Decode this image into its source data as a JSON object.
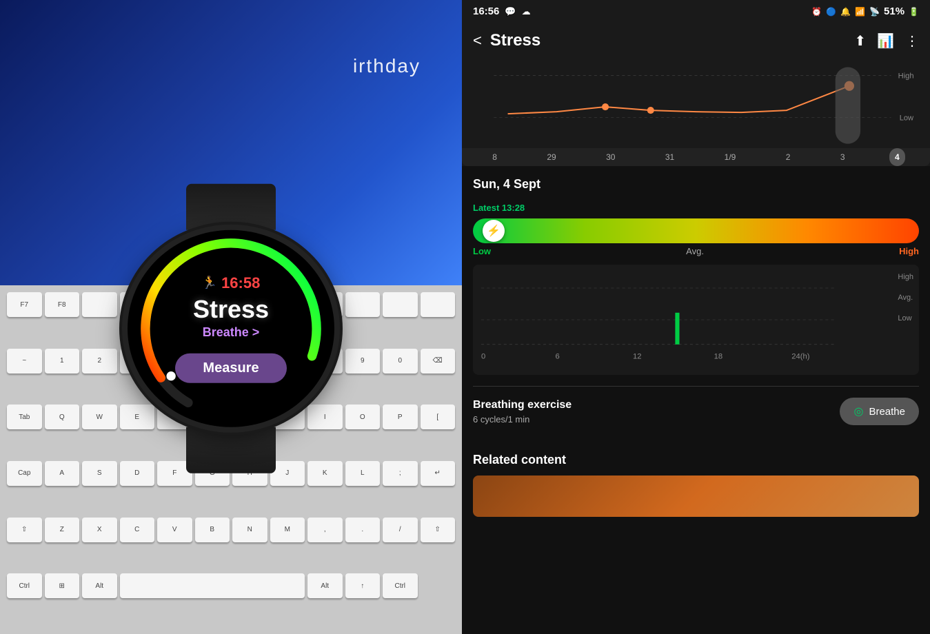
{
  "left_panel": {
    "birthday_text": "irthday",
    "watch": {
      "time": "16:58",
      "stress_label": "Stress",
      "breathe_label": "Breathe >",
      "measure_label": "Measure"
    }
  },
  "right_panel": {
    "status_bar": {
      "time": "16:56",
      "battery": "51%",
      "icons": "📱🔔📶"
    },
    "header": {
      "title": "Stress",
      "back_label": "<",
      "share_icon": "share",
      "chart_icon": "chart",
      "more_icon": "more"
    },
    "chart": {
      "y_labels": [
        "High",
        "Low"
      ],
      "x_labels": [
        "8",
        "29",
        "30",
        "31",
        "1/9",
        "2",
        "3",
        "4"
      ]
    },
    "date_heading": "Sun, 4 Sept",
    "latest_label": "Latest 13:28",
    "stress_bar": {
      "low_label": "Low",
      "avg_label": "Avg.",
      "high_label": "High"
    },
    "daily_chart": {
      "y_labels": [
        "High",
        "Avg.",
        "Low"
      ],
      "x_labels": [
        "0",
        "6",
        "12",
        "18",
        "24(h)"
      ]
    },
    "breathe_section": {
      "title": "Breathing exercise",
      "subtitle": "6 cycles/1 min",
      "button_label": "Breathe"
    },
    "related_section": {
      "title": "Related content"
    }
  }
}
